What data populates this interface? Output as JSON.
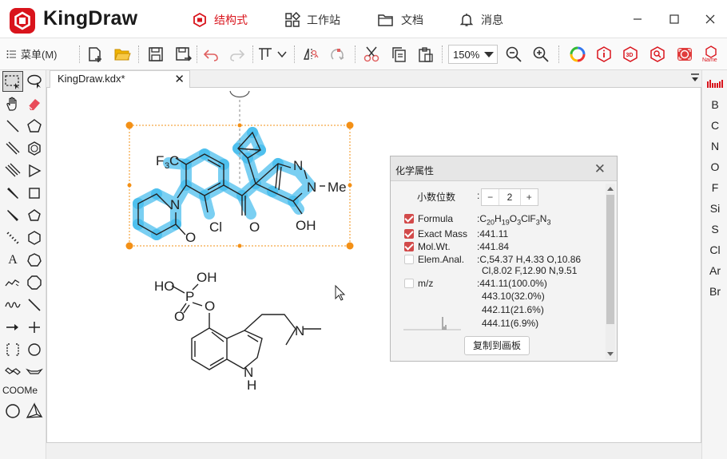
{
  "app": {
    "title": "KingDraw"
  },
  "nav": {
    "tabs": [
      {
        "label": "结构式",
        "icon": "hexagon-icon",
        "active": true
      },
      {
        "label": "工作站",
        "icon": "grid-icon",
        "active": false
      },
      {
        "label": "文档",
        "icon": "folder-icon",
        "active": false
      },
      {
        "label": "消息",
        "icon": "bell-icon",
        "active": false
      }
    ]
  },
  "toolbar": {
    "menu_label": "菜单(M)",
    "zoom": "150%",
    "name_icon_text": "Name"
  },
  "document": {
    "tab_title": "KingDraw.kdx*"
  },
  "left_tools": {
    "text_tool": "A",
    "coome_label": "COOMe"
  },
  "right_panel": {
    "elements": [
      "B",
      "C",
      "N",
      "O",
      "F",
      "Si",
      "S",
      "Cl",
      "Ar",
      "Br"
    ]
  },
  "properties": {
    "title": "化学属性",
    "decimal_label": "小数位数",
    "decimal_value": "2",
    "stepper_minus": "−",
    "stepper_plus": "+",
    "rows": [
      {
        "label": "Formula",
        "checked": true,
        "value": ""
      },
      {
        "label": "Exact Mass",
        "checked": true,
        "value": "441.11"
      },
      {
        "label": "Mol.Wt.",
        "checked": true,
        "value": "441.84"
      },
      {
        "label": "Elem.Anal.",
        "checked": false,
        "value": "C,54.37 H,4.33 O,10.86",
        "value2": "Cl,8.02 F,12.90 N,9.51"
      },
      {
        "label": "m/z",
        "checked": false,
        "value": "441.11(100.0%)"
      }
    ],
    "formula_parts": [
      "C",
      "20",
      "H",
      "19",
      "O",
      "3",
      "ClF",
      "3",
      "N",
      "3"
    ],
    "mz_extra": [
      "443.10(32.0%)",
      "442.11(21.6%)",
      "444.11(6.9%)"
    ],
    "copy_button": "复制到画板"
  },
  "molecule1": {
    "labels": {
      "cf3_main": "F",
      "cf3_sub": "3",
      "cf3_c": "C",
      "ring_n": "N",
      "ring_o": "O",
      "cl": "Cl",
      "ketone_o": "O",
      "pz_n1": "N",
      "pz_n2": "N",
      "methyl": "Me",
      "oh": "OH"
    }
  },
  "molecule2": {
    "labels": {
      "ho": "HO",
      "oh": "OH",
      "p": "P",
      "o_ester": "O",
      "o_double": "O",
      "nh_n": "N",
      "nh_h": "H",
      "amine_n": "N"
    }
  },
  "colors": {
    "brand": "#d9141c",
    "selection": "#4ec0ee",
    "handle": "#f39016"
  }
}
